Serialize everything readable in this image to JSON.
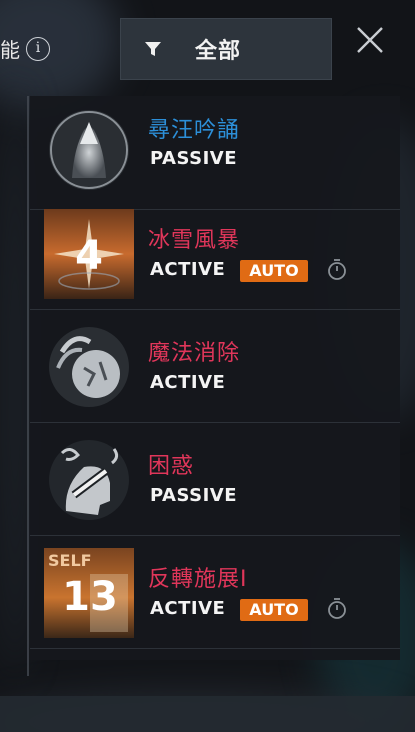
{
  "header": {
    "title_fragment": "能",
    "info_icon": "info-icon",
    "filter_label": "全部",
    "filter_icon": "filter-icon",
    "close_icon": "close-icon"
  },
  "skills": [
    {
      "name": "尋汪吟誦",
      "type": "PASSIVE",
      "auto": false,
      "timer": false,
      "name_color": "#2c8fd8",
      "icon": "hands-praying-icon"
    },
    {
      "name": "冰雪風暴",
      "type": "ACTIVE",
      "auto": true,
      "auto_label": "AUTO",
      "timer": true,
      "name_color": "#e0365a",
      "icon": "blizzard-skill-icon",
      "icon_number": "4"
    },
    {
      "name": "魔法消除",
      "type": "ACTIVE",
      "auto": false,
      "timer": false,
      "name_color": "#e0365a",
      "icon": "dispel-magic-icon"
    },
    {
      "name": "困惑",
      "type": "PASSIVE",
      "auto": false,
      "timer": false,
      "name_color": "#e0365a",
      "icon": "confusion-icon"
    },
    {
      "name": "反轉施展Ⅰ",
      "type": "ACTIVE",
      "auto": true,
      "auto_label": "AUTO",
      "timer": true,
      "name_color": "#e0365a",
      "icon": "reverse-cast-skill-icon",
      "icon_tag": "SELF",
      "icon_number": "13"
    }
  ]
}
